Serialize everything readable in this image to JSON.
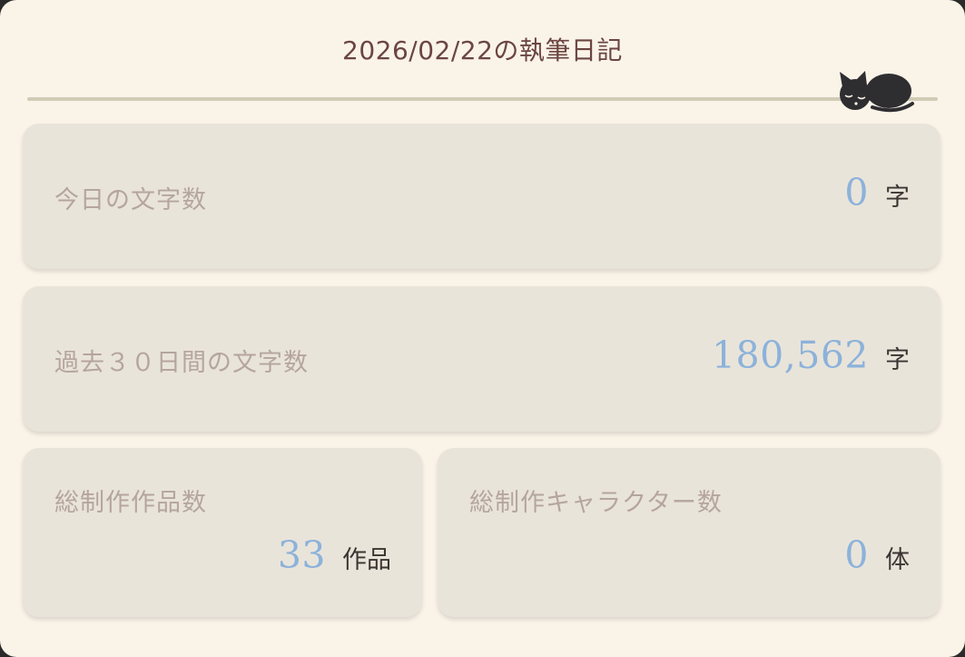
{
  "header": {
    "title": "2026/02/22の執筆日記",
    "mascot_icon": "sleeping-cat-icon"
  },
  "stats": {
    "today": {
      "label": "今日の文字数",
      "value": "0",
      "unit": "字"
    },
    "last30": {
      "label": "過去３０日間の文字数",
      "value": "180,562",
      "unit": "字"
    },
    "works": {
      "label": "総制作作品数",
      "value": "33",
      "unit": "作品"
    },
    "characters": {
      "label": "総制作キャラクター数",
      "value": "0",
      "unit": "体"
    }
  },
  "colors": {
    "background": "#faf3e8",
    "card": "#e9e4da",
    "title": "#6b4540",
    "label": "#b5a59f",
    "value": "#8cb2da",
    "unit": "#3c3432",
    "rule": "#cfccb6"
  }
}
